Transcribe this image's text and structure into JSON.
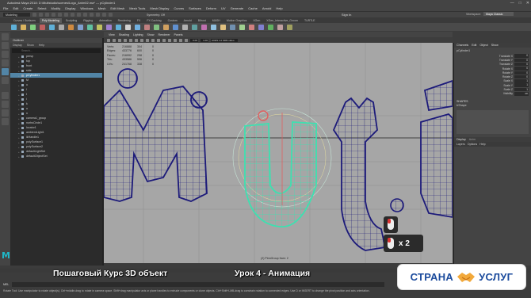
{
  "window": {
    "title": "Autodesk Maya 2018: D:\\Multstudio\\scenes\\Logo_Anim02.ma* --- pCylinder1",
    "controls": [
      "—",
      "□",
      "✕"
    ]
  },
  "menubar": [
    "File",
    "Edit",
    "Create",
    "Select",
    "Modify",
    "Display",
    "Windows",
    "Mesh",
    "Edit Mesh",
    "Mesh Tools",
    "Mesh Display",
    "Curves",
    "Surfaces",
    "Deform",
    "UV",
    "Generate",
    "Cache",
    "Arnold",
    "Help"
  ],
  "statusline": {
    "mode": "Modeling",
    "symmetry": "Symmetry: Off",
    "signin": "Sign In",
    "workspace_label": "Workspace:",
    "workspace_value": "Maya Classic"
  },
  "shelf": {
    "tabs": [
      "Curves / Surfaces",
      "Poly Modeling",
      "Sculpting",
      "Rigging",
      "Animation",
      "Rendering",
      "FX",
      "FX Caching",
      "Custom",
      "Arnold",
      "Bifrost",
      "MASH",
      "Motion Graphics",
      "XGen",
      "XGen_Interactive_Groom",
      "TURTLE"
    ],
    "active_index": 1,
    "icon_colors": [
      "#5fb0d8",
      "#d8b35f",
      "#7fd07f",
      "#c06060",
      "#5fb0d8",
      "#aaaaaa",
      "#d08a40",
      "#7fa0d0",
      "#60c0a0",
      "#c0c060",
      "#9f7fd0",
      "#5fb0d8",
      "#d0d0d0",
      "#70b0e0",
      "#c08080",
      "#80c080",
      "#d0a060",
      "#6090d0",
      "#b0b0b0",
      "#60a0a0",
      "#c070b0",
      "#90c0e0",
      "#e0c080",
      "#7090b0",
      "#a0d090",
      "#d08080",
      "#8080d0",
      "#60b060",
      "#c0a0a0",
      "#a0a060"
    ]
  },
  "outliner": {
    "title": "Outliner",
    "menu": [
      "Display",
      "Show",
      "Help"
    ],
    "search_placeholder": "Search...",
    "items": [
      {
        "label": "persp",
        "selected": false
      },
      {
        "label": "top",
        "selected": false
      },
      {
        "label": "front",
        "selected": false
      },
      {
        "label": "side",
        "selected": false
      },
      {
        "label": "pCylinder1",
        "selected": true
      },
      {
        "label": "M",
        "selected": false
      },
      {
        "label": "u",
        "selected": false
      },
      {
        "label": "l",
        "selected": false
      },
      {
        "label": "t",
        "selected": false
      },
      {
        "label": "i",
        "selected": false
      },
      {
        "label": "k",
        "selected": false
      },
      {
        "label": "o",
        "selected": false
      },
      {
        "label": "n",
        "selected": false
      },
      {
        "label": "camera1_group",
        "selected": false
      },
      {
        "label": "nurbsCircle1",
        "selected": false
      },
      {
        "label": "locator1",
        "selected": false
      },
      {
        "label": "ambientLight1",
        "selected": false
      },
      {
        "label": "ikHandle1",
        "selected": false
      },
      {
        "label": "polySurface1",
        "selected": false
      },
      {
        "label": "polySurface2",
        "selected": false
      },
      {
        "label": "defaultLightSet",
        "selected": false
      },
      {
        "label": "defaultObjectSet",
        "selected": false
      }
    ]
  },
  "viewport": {
    "menu": [
      "View",
      "Shading",
      "Lighting",
      "Show",
      "Renderer",
      "Panels"
    ],
    "toolbar_values": [
      "0.00",
      "1.00",
      "ACES 1.0 SDR-video (sRGB)"
    ],
    "hud": [
      {
        "k": "Verts:",
        "a": "216888",
        "b": "304",
        "c": "0"
      },
      {
        "k": "Edges:",
        "a": "433776",
        "b": "600",
        "c": "0"
      },
      {
        "k": "Faces:",
        "a": "216992",
        "b": "298",
        "c": "0"
      },
      {
        "k": "Tris:",
        "a": "433586",
        "b": "596",
        "c": "0"
      },
      {
        "k": "UVs:",
        "a": "241768",
        "b": "338",
        "c": "0"
      }
    ],
    "camera_label": "(2) PinnGroup   fram: 2"
  },
  "channelbox": {
    "tabs": [
      "Channels",
      "Edit",
      "Object",
      "Show"
    ],
    "object": "pCylinder1",
    "attrs": [
      {
        "k": "Translate X",
        "v": "0"
      },
      {
        "k": "Translate Y",
        "v": "0"
      },
      {
        "k": "Translate Z",
        "v": "0"
      },
      {
        "k": "Rotate X",
        "v": "0"
      },
      {
        "k": "Rotate Y",
        "v": "0"
      },
      {
        "k": "Rotate Z",
        "v": "0"
      },
      {
        "k": "Scale X",
        "v": "1"
      },
      {
        "k": "Scale Y",
        "v": "1"
      },
      {
        "k": "Scale Z",
        "v": "1"
      },
      {
        "k": "Visibility",
        "v": "on"
      }
    ],
    "shapes_label": "SHAPES",
    "shape_name": "trShape",
    "display_tabs": [
      "Display",
      "Anim"
    ],
    "layers_menu": [
      "Layers",
      "Options",
      "Help"
    ]
  },
  "bottom": {
    "mel": "MEL",
    "help": "Rotate Tool: Use manipulator to rotate object(s). Ctrl+middle-drag to rotate in camera space. Shift+drag manipulator axis or plane handles to extrude components or clone objects. Ctrl+Shift+LMB-drag to constrain rotation to connected edges. Use D or INSERT to change the pivot position and axis orientation."
  },
  "captions": {
    "left": "Пошаговый Курс 3D объект",
    "right": "Урок 4 - Анимация"
  },
  "watermark": {
    "left": "СТРАНА",
    "right": "УСЛУГ"
  },
  "mouse_hint": {
    "multiplier": "x 2"
  },
  "colors": {
    "accent": "#5285a6",
    "wire": "#1c1a7a",
    "selected_wire": "#3ee0b0",
    "viewport_bg": "#a6a6a6",
    "brand": "#1a4a9c"
  }
}
